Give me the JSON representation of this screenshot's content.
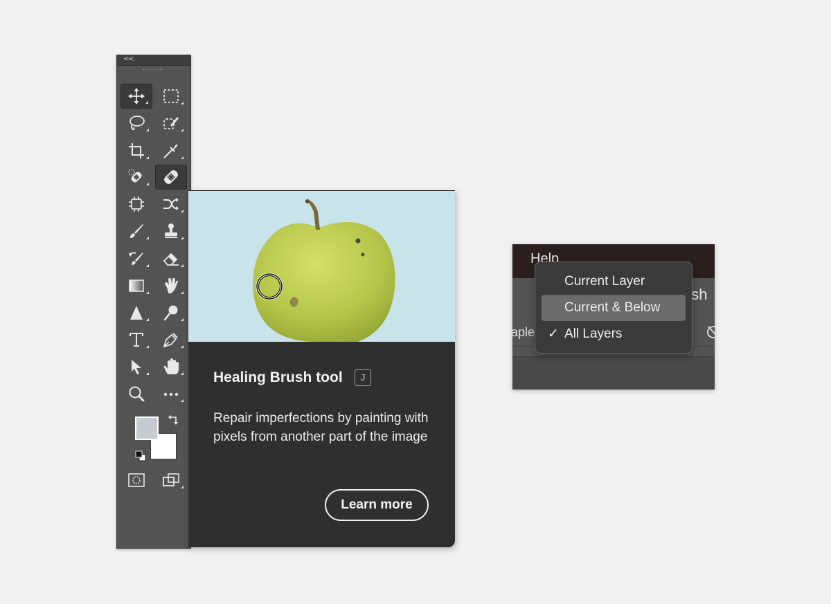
{
  "toolbar": {
    "collapse_label": "<<",
    "tools": [
      {
        "id": "move-tool",
        "icon": "move-icon",
        "selected": true
      },
      {
        "id": "marquee-tool",
        "icon": "rectangular-marquee-icon"
      },
      {
        "id": "lasso-tool",
        "icon": "lasso-icon"
      },
      {
        "id": "object-selection-tool",
        "icon": "object-selection-icon"
      },
      {
        "id": "crop-tool",
        "icon": "crop-icon"
      },
      {
        "id": "eyedropper-tool",
        "icon": "eyedropper-icon"
      },
      {
        "id": "spot-healing-tool",
        "icon": "spot-healing-icon"
      },
      {
        "id": "healing-brush-tool",
        "icon": "healing-brush-icon",
        "selected": true
      },
      {
        "id": "generative-fill-tool",
        "icon": "frame-chip-icon"
      },
      {
        "id": "content-aware-move-tool",
        "icon": "shuffle-icon"
      },
      {
        "id": "brush-tool",
        "icon": "brush-icon"
      },
      {
        "id": "clone-stamp-tool",
        "icon": "stamp-icon"
      },
      {
        "id": "history-brush-tool",
        "icon": "history-brush-icon"
      },
      {
        "id": "eraser-tool",
        "icon": "eraser-icon"
      },
      {
        "id": "gradient-tool",
        "icon": "gradient-icon"
      },
      {
        "id": "smudge-tool",
        "icon": "smudge-icon"
      },
      {
        "id": "blur-tool",
        "icon": "triangle-icon"
      },
      {
        "id": "dodge-tool",
        "icon": "dodge-icon"
      },
      {
        "id": "type-tool",
        "icon": "type-icon"
      },
      {
        "id": "pen-tool",
        "icon": "pen-icon"
      },
      {
        "id": "path-selection-tool",
        "icon": "arrow-icon"
      },
      {
        "id": "hand-tool",
        "icon": "hand-icon"
      },
      {
        "id": "zoom-tool",
        "icon": "zoom-icon"
      },
      {
        "id": "more-tools",
        "icon": "more-icon"
      }
    ],
    "foreground_color": "#c5cbd0",
    "background_color": "#ffffff",
    "bottom_icons": [
      "quick-mask-icon",
      "screen-mode-icon"
    ]
  },
  "tooltip": {
    "title": "Healing Brush tool",
    "shortcut": "J",
    "description": "Repair imperfections by painting with pixels from another part of the image",
    "button_label": "Learn more",
    "image_bg": "#c9e3ea"
  },
  "sample_menu": {
    "menubar_label": "Help",
    "partial_right_text": "osh",
    "partial_left_text": "aple",
    "items": [
      {
        "label": "Current Layer",
        "checked": false,
        "highlighted": false
      },
      {
        "label": "Current & Below",
        "checked": false,
        "highlighted": true
      },
      {
        "label": "All Layers",
        "checked": true,
        "highlighted": false
      }
    ],
    "check_glyph": "✓"
  }
}
